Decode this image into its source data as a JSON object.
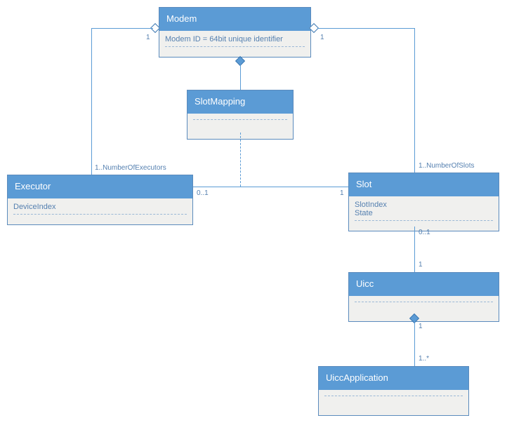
{
  "modem": {
    "title": "Modem",
    "attr": "Modem ID = 64bit unique identifier"
  },
  "slotmapping": {
    "title": "SlotMapping"
  },
  "executor": {
    "title": "Executor",
    "attr": "DeviceIndex"
  },
  "slot": {
    "title": "Slot",
    "attr1": "SlotIndex",
    "attr2": "State"
  },
  "uicc": {
    "title": "Uicc"
  },
  "uiccapp": {
    "title": "UiccApplication"
  },
  "mult": {
    "modem_left": "1",
    "modem_right": "1",
    "exec_top": "1..NumberOfExecutors",
    "slot_top": "1..NumberOfSlots",
    "exec_right": "0..1",
    "slot_left": "1",
    "slot_bottom": "0..1",
    "uicc_top": "1",
    "uicc_bottom": "1",
    "uiccapp_top": "1..*"
  }
}
